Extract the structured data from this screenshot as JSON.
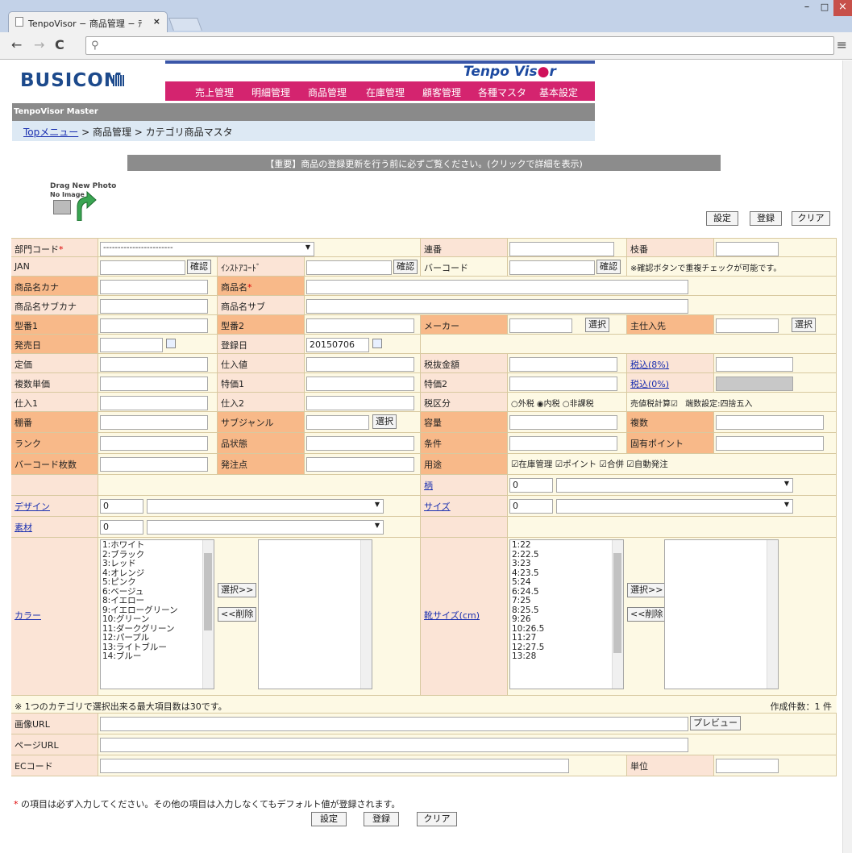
{
  "browser": {
    "tab_title": "TenpoVisor − 商品管理 − ﾃ",
    "url": "",
    "minimize": "–",
    "maximize": "□",
    "close": "×"
  },
  "header": {
    "logo": "BUSICOM",
    "product_logo_a": "Tenpo Vis",
    "product_logo_b": "r",
    "menu": [
      "売上管理",
      "明細管理",
      "商品管理",
      "在庫管理",
      "顧客管理",
      "各種マスタ",
      "基本設定"
    ],
    "system_name": "TenpoVisor Master",
    "breadcrumb_top": "Topメニュー",
    "breadcrumb_rest": " > 商品管理 > カテゴリ商品マスタ"
  },
  "notice": "【重要】商品の登録更新を行う前に必ずご覧ください。(クリックで詳細を表示)",
  "photo": {
    "drag_label": "Drag New Photo",
    "no_image": "No Image"
  },
  "buttons": {
    "settings": "設定",
    "register": "登録",
    "clear": "クリア",
    "confirm": "確認",
    "select": "選択",
    "preview": "プレビュー",
    "select_add": "選択>>",
    "remove": "<<削除"
  },
  "form": {
    "bumon_label": "部門コード",
    "bumon_value": "------------------------",
    "renban_label": "連番",
    "edaban_label": "枝番",
    "jan_label": "JAN",
    "instore_label": "ｲﾝｽﾄｱｺｰﾄﾞ",
    "barcode_label": "バーコード",
    "dup_note": "※確認ボタンで重複チェックが可能です。",
    "kana_label": "商品名カナ",
    "name_label": "商品名",
    "subkana_label": "商品名サブカナ",
    "subname_label": "商品名サブ",
    "model1_label": "型番1",
    "model2_label": "型番2",
    "maker_label": "メーカー",
    "supplier_label": "主仕入先",
    "release_label": "発売日",
    "regdate_label": "登録日",
    "regdate_value": "20150706",
    "list_price_label": "定価",
    "cost_label": "仕入値",
    "pretax_label": "税抜金額",
    "taxin8_label": "税込(8%)",
    "multi_price_label": "複数単価",
    "special1_label": "特価1",
    "special2_label": "特価2",
    "taxin0_label": "税込(0%)",
    "purchase1_label": "仕入1",
    "purchase2_label": "仕入2",
    "taxtype_label": "税区分",
    "tax_ex": "外税",
    "tax_in": "内税",
    "tax_free": "非課税",
    "sales_tax_calc": "売値税計算",
    "rounding": "端数設定:四捨五入",
    "shelf_label": "棚番",
    "subgenre_label": "サブジャンル",
    "capacity_label": "容量",
    "multiple_label": "複数",
    "rank_label": "ランク",
    "condition_label": "品状態",
    "terms_label": "条件",
    "points_label": "固有ポイント",
    "barcode_count_label": "バーコード枚数",
    "reorder_label": "発注点",
    "usage_label": "用途",
    "usage_opts": [
      "在庫管理",
      "ポイント",
      "合併",
      "自動発注"
    ],
    "pattern_label": "柄",
    "pattern_value": "0",
    "design_label": "デザイン",
    "design_value": "0",
    "size_label": "サイズ",
    "size_value": "0",
    "material_label": "素材",
    "material_value": "0",
    "color_label": "カラー",
    "colors": [
      "1:ホワイト",
      "2:ブラック",
      "3:レッド",
      "4:オレンジ",
      "5:ピンク",
      "6:ベージュ",
      "8:イエロー",
      "9:イエローグリーン",
      "10:グリーン",
      "11:ダークグリーン",
      "12:パープル",
      "13:ライトブルー",
      "14:ブルー"
    ],
    "shoe_label": "靴サイズ(cm)",
    "shoe_sizes": [
      "1:22",
      "2:22.5",
      "3:23",
      "4:23.5",
      "5:24",
      "6:24.5",
      "7:25",
      "8:25.5",
      "9:26",
      "10:26.5",
      "11:27",
      "12:27.5",
      "13:28"
    ],
    "max_note": "※ 1つのカテゴリで選択出来る最大項目数は30です。",
    "created_count": "作成件数：1 件",
    "image_url_label": "画像URL",
    "page_url_label": "ページURL",
    "ec_code_label": "ECコード",
    "unit_label": "単位"
  },
  "footer_note": "の項目は必ず入力してください。その他の項目は入力しなくてもデフォルト値が登録されます。",
  "required_mark": "*"
}
